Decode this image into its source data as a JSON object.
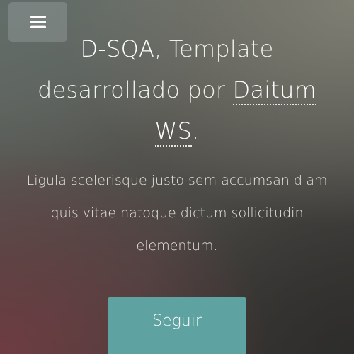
{
  "nav": {
    "menu_icon": "hamburger-icon"
  },
  "hero": {
    "title": {
      "brand": "D-SQA",
      "before_link": ", Template desarrollado por ",
      "link_text": "Daitum WS",
      "after_link": "."
    },
    "subtitle": "Ligula scelerisque justo sem accumsan diam quis vitae natoque dictum sollicitudin elementum.",
    "cta_label": "Seguir"
  },
  "colors": {
    "button_accent": "#5ea3a1",
    "menu_button_bg": "#969e9e",
    "text": "#eef0ea"
  }
}
